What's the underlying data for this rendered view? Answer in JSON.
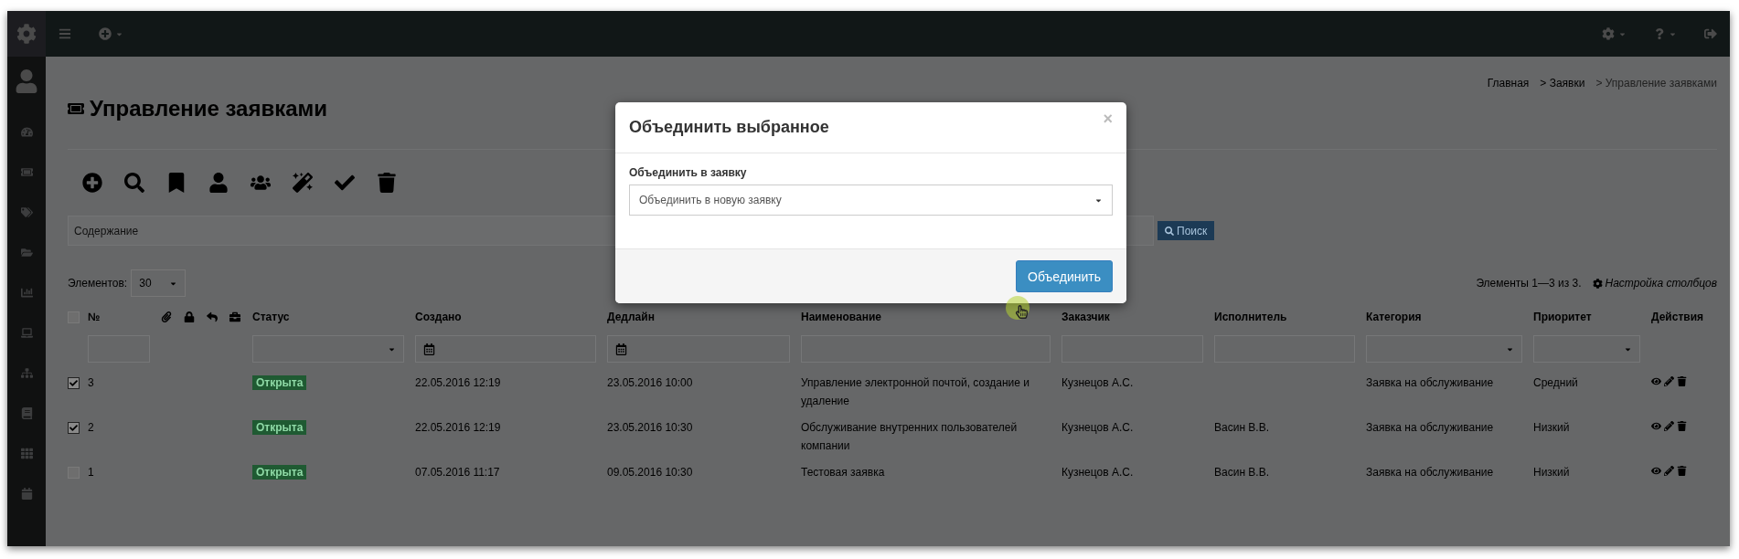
{
  "breadcrumb": [
    "Главная",
    "> Заявки",
    "> Управление заявками"
  ],
  "page_title": "Управление заявками",
  "search": {
    "placeholder": "Содержание",
    "button": "Поиск"
  },
  "page_size": {
    "label": "Элементов:",
    "value": "30"
  },
  "summary": "Элементы 1—3 из 3.",
  "columns_settings": "Настройка столбцов",
  "select_all": {
    "checked": false
  },
  "columns": [
    {
      "kind": "text",
      "label": "№"
    },
    {
      "kind": "icon"
    },
    {
      "kind": "icon"
    },
    {
      "kind": "icon"
    },
    {
      "kind": "icon"
    },
    {
      "kind": "select",
      "label": "Статус"
    },
    {
      "kind": "date",
      "label": "Создано"
    },
    {
      "kind": "date",
      "label": "Дедлайн"
    },
    {
      "kind": "text",
      "label": "Наименование"
    },
    {
      "kind": "text",
      "label": "Заказчик"
    },
    {
      "kind": "text",
      "label": "Исполнитель"
    },
    {
      "kind": "select",
      "label": "Категория"
    },
    {
      "kind": "select",
      "label": "Приоритет"
    },
    {
      "kind": "none",
      "label": "Действия"
    }
  ],
  "rows": [
    {
      "checked": true,
      "number": "3",
      "status": "Открыта",
      "color": "#1f5a32",
      "created": "22.05.2016 12:19",
      "deadline": "23.05.2016 10:00",
      "name": "Управление электронной почтой, создание и удаление",
      "customer": "Кузнецов А.С.",
      "executor": "",
      "category": "Заявка на обслуживание",
      "priority": "Средний"
    },
    {
      "checked": true,
      "number": "2",
      "status": "Открыта",
      "color": "#1f5a32",
      "created": "22.05.2016 12:19",
      "deadline": "23.05.2016 10:30",
      "name": "Обслуживание внутренних пользователей компании",
      "customer": "Кузнецов А.С.",
      "executor": "Васин В.В.",
      "category": "Заявка на обслуживание",
      "priority": "Низкий"
    },
    {
      "checked": false,
      "number": "1",
      "status": "Открыта",
      "color": "#1f5a32",
      "created": "07.05.2016 11:17",
      "deadline": "09.05.2016 10:30",
      "name": "Тестовая заявка",
      "customer": "Кузнецов А.С.",
      "executor": "Васин В.В.",
      "category": "Заявка на обслуживание",
      "priority": "Низкий"
    }
  ],
  "modal": {
    "title": "Объединить выбранное",
    "close": "×",
    "field_label": "Объединить в заявку",
    "select_value": "Объединить в новую заявку",
    "button": "Объединить"
  }
}
